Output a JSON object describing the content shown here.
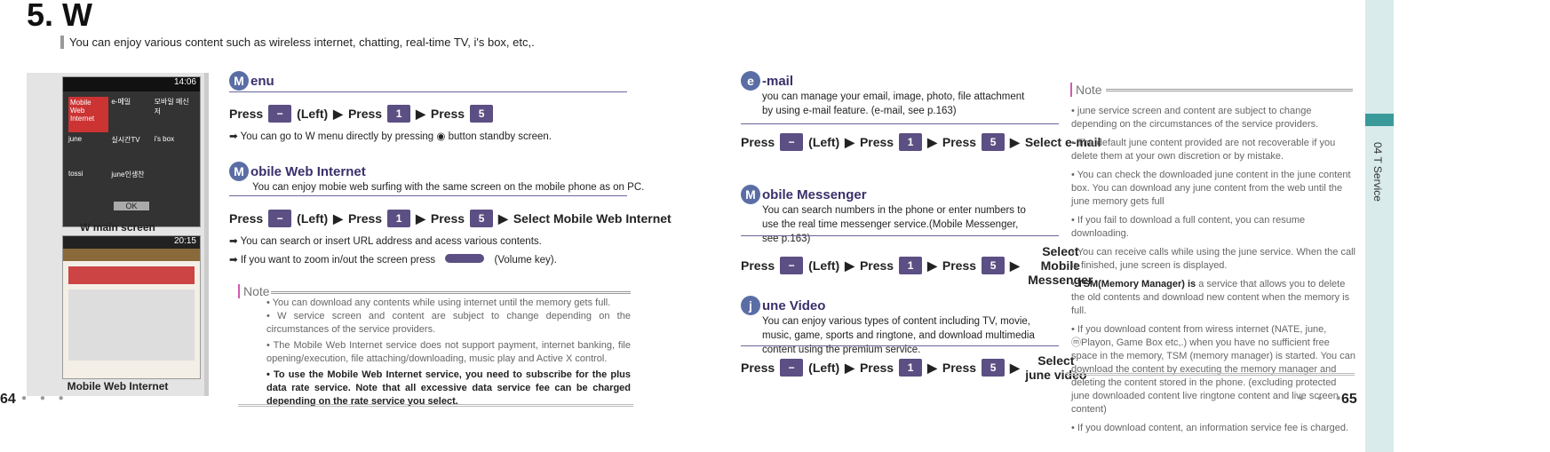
{
  "header": {
    "title": "5. W",
    "intro": "You can enjoy various content such as wireless internet, chatting, real-time TV, i's box, etc,."
  },
  "screens": {
    "main_caption": "W  main  screen",
    "web_caption": "Mobile  Web  Internet",
    "main_time": "14:06",
    "web_time": "20:15",
    "main_ok": "OK",
    "main_items": [
      "Mobile Web Internet",
      "e-메일",
      "모바일 메신저",
      "june",
      "실시간TV",
      "i's box",
      "tossi",
      "june인생찬"
    ]
  },
  "menu": {
    "badge": "M",
    "title": "enu",
    "press": [
      "Press",
      "(Left)",
      "Press",
      "Press"
    ],
    "keys": [
      "",
      "1",
      "5"
    ],
    "tip": "You can go to W menu directly by pressing",
    "tip2": "button standby screen."
  },
  "mobile_web": {
    "badge": "M",
    "title": "obile Web Internet",
    "desc": "You can enjoy mobie web surfing with the same screen on the mobile phone as on PC.",
    "press": [
      "Press",
      "(Left)",
      "Press",
      "Press",
      "Select Mobile Web Internet"
    ],
    "tips": [
      "You can search or insert URL address and acess various contents.",
      "If you want to zoom in/out the screen press",
      "(Volume key)."
    ]
  },
  "note_left": {
    "label": "Note",
    "items": [
      "You can download any contents while using internet until the memory gets full.",
      "W service screen and content are subject to change depending on the circumstances of the service providers.",
      "The Mobile Web Internet service does not support payment, internet banking, file opening/execution, file attaching/downloading, music play and Active X control."
    ],
    "bold_item": "To use the Mobile Web Internet service, you need to subscribe for the plus data rate service. Note that all excessive data service fee can be charged depending on the rate service you select."
  },
  "email": {
    "badge": "e",
    "title": "-mail",
    "desc": "you can manage your email, image, photo, file attachment by using e-mail feature. (e-mail, see p.163)",
    "press": [
      "Press",
      "(Left)",
      "Press",
      "Press",
      "Select e-mail"
    ]
  },
  "messenger": {
    "badge": "M",
    "title": "obile Messenger",
    "desc": "You can search numbers in the phone or enter numbers to use the real time messenger service.(Mobile Messenger, see p.163)",
    "press": [
      "Press",
      "(Left)",
      "Press",
      "Press",
      "Select Mobile Messenger"
    ]
  },
  "june": {
    "badge": "j",
    "title": "une Video",
    "desc": "You can enjoy various types of content including TV, movie, music, game, sports and ringtone, and download multimedia content using the premium service.",
    "press": [
      "Press",
      "(Left)",
      "Press",
      "Press",
      "Select june video"
    ]
  },
  "note_right": {
    "label": "Note",
    "items": [
      "june service screen and content are subject to change depending on the circumstances of the service providers.",
      "The default june content provided are not recoverable if you delete them at your own discretion or by mistake.",
      "You can check the downloaded june content in the june content box. You can download any june content from the web until the june memory gets full",
      "If you fail to download a full content, you can resume downloading.",
      "You can receive calls while using the june service. When the call is finished, june screen is displayed."
    ],
    "tsm_bold": "TSM(Memory Manager) is",
    "tsm_rest": "a service that allows you to delete the old contents and download new content when the memory is full.",
    "items2": [
      "If you download content from wiress internet (NATE, june, ⓜPlayon, Game Box etc,.) when you have no sufficient free space in the memory, TSM (memory manager) is started. You can download the content by executing the memory manager and deleting the content stored in the phone. (excluding protected june downloaded content live ringtone content and live screen content)",
      "If you download content, an information service fee is charged."
    ]
  },
  "side_tab": "04 T Service",
  "pages": {
    "left": "64",
    "right": "65"
  },
  "colors": {
    "accent": "#5b4f83",
    "badge": "#5a6ea5",
    "side": "#d9ebeb"
  }
}
